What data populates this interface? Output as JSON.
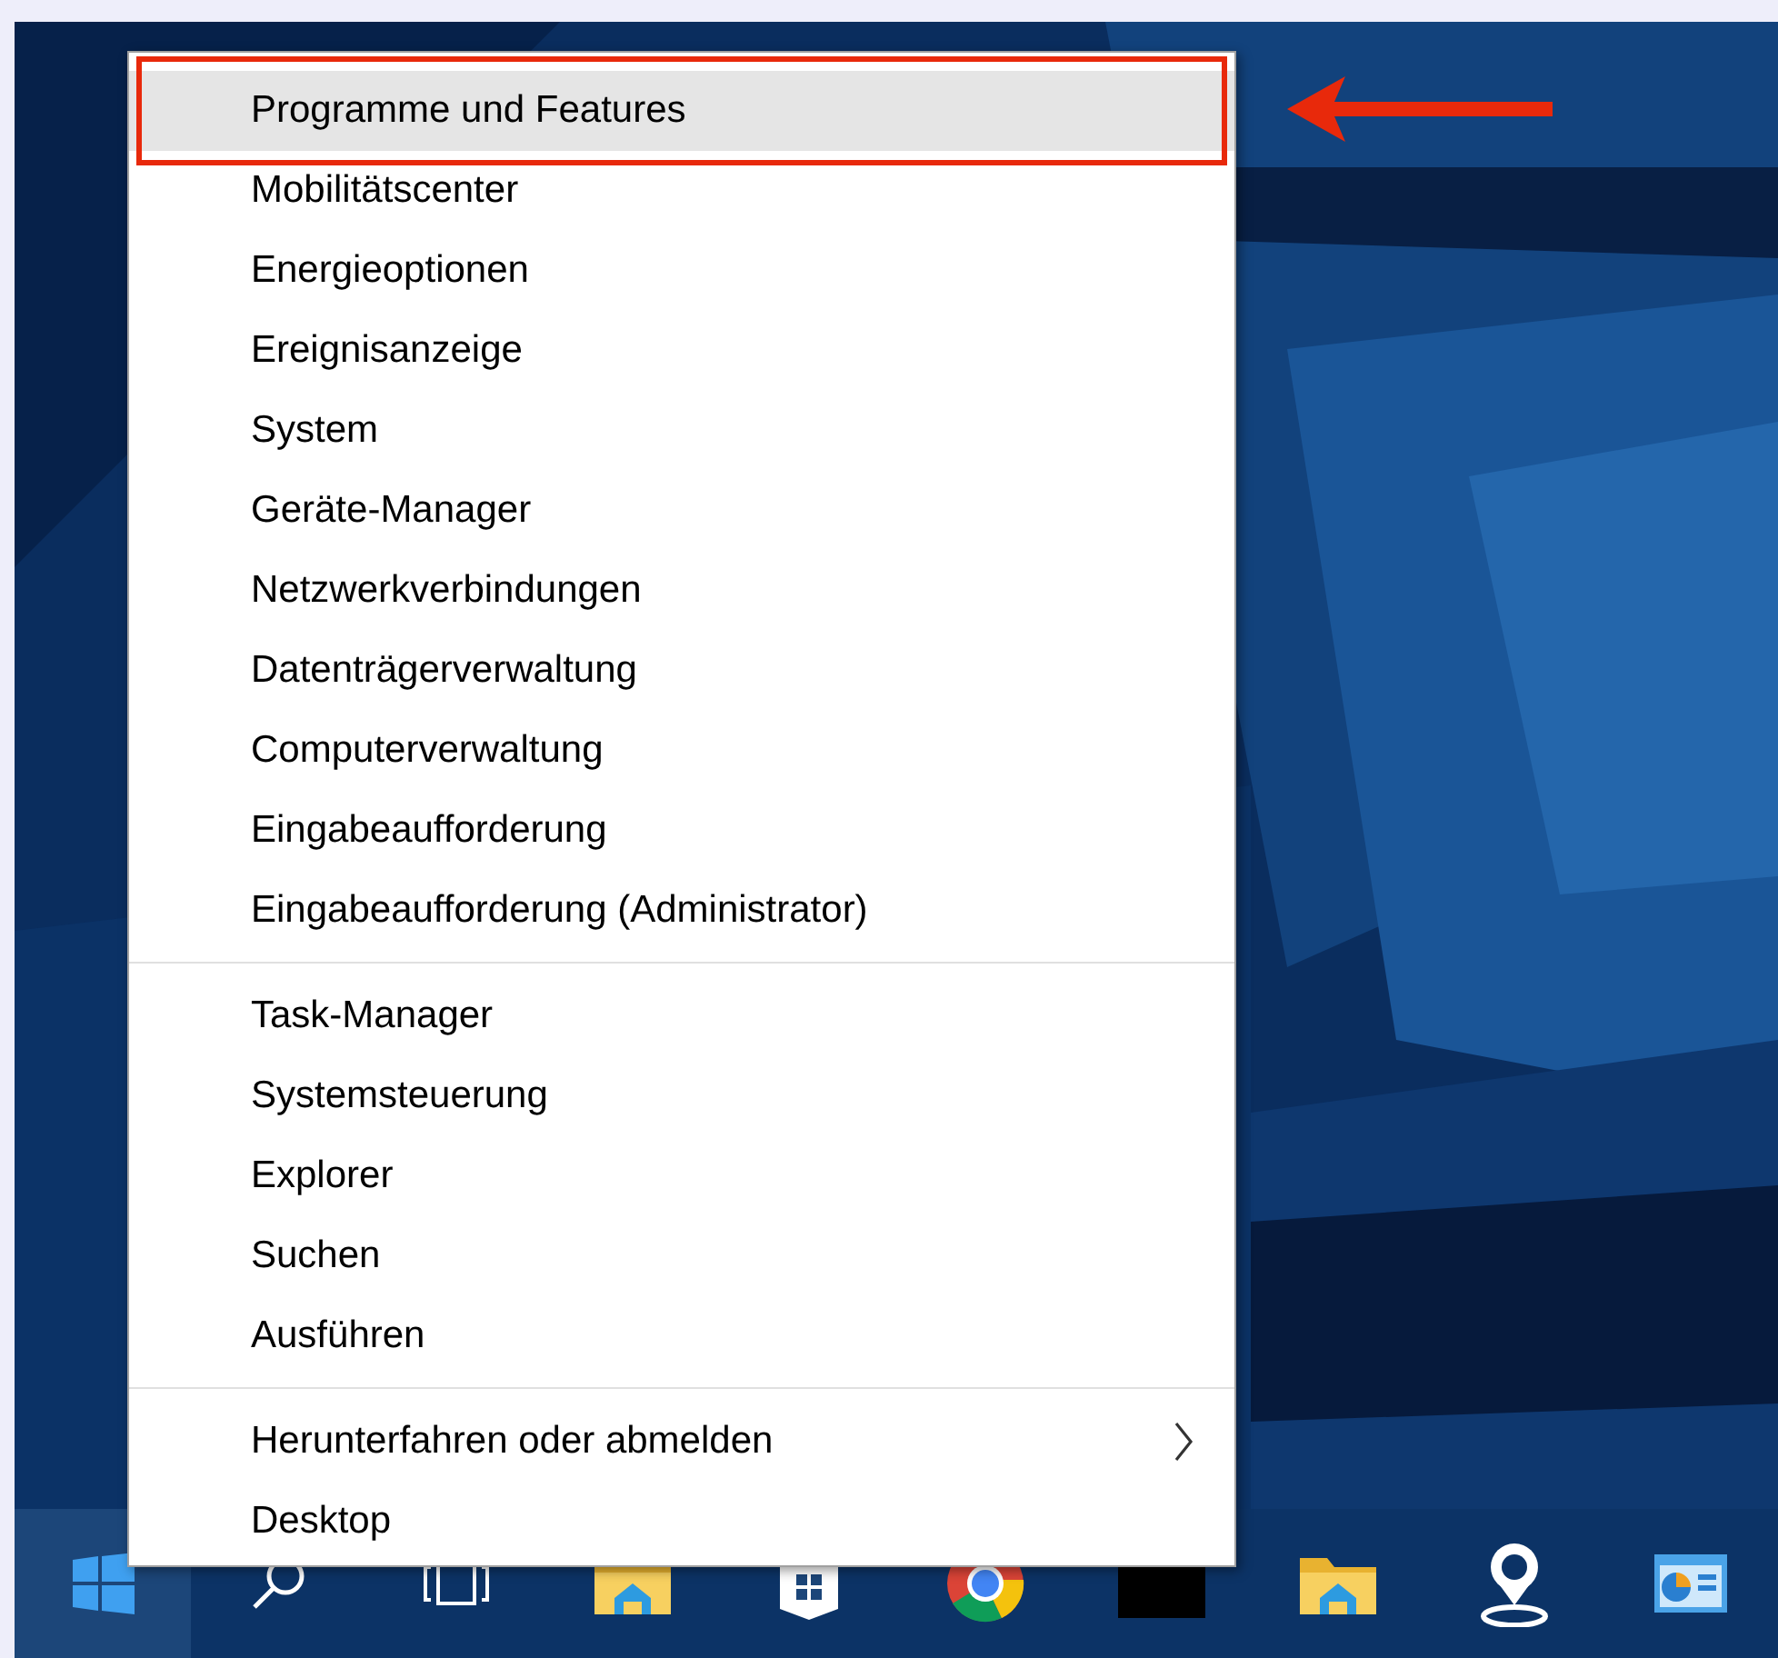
{
  "menu": {
    "groups": [
      {
        "items": [
          {
            "label": "Programme und Features",
            "selected": true,
            "annotated": true,
            "submenu": false
          },
          {
            "label": "Mobilitätscenter",
            "selected": false,
            "annotated": false,
            "submenu": false
          },
          {
            "label": "Energieoptionen",
            "selected": false,
            "annotated": false,
            "submenu": false
          },
          {
            "label": "Ereignisanzeige",
            "selected": false,
            "annotated": false,
            "submenu": false
          },
          {
            "label": "System",
            "selected": false,
            "annotated": false,
            "submenu": false
          },
          {
            "label": "Geräte-Manager",
            "selected": false,
            "annotated": false,
            "submenu": false
          },
          {
            "label": "Netzwerkverbindungen",
            "selected": false,
            "annotated": false,
            "submenu": false
          },
          {
            "label": "Datenträgerverwaltung",
            "selected": false,
            "annotated": false,
            "submenu": false
          },
          {
            "label": "Computerverwaltung",
            "selected": false,
            "annotated": false,
            "submenu": false
          },
          {
            "label": "Eingabeaufforderung",
            "selected": false,
            "annotated": false,
            "submenu": false
          },
          {
            "label": "Eingabeaufforderung (Administrator)",
            "selected": false,
            "annotated": false,
            "submenu": false
          }
        ]
      },
      {
        "items": [
          {
            "label": "Task-Manager",
            "selected": false,
            "annotated": false,
            "submenu": false
          },
          {
            "label": "Systemsteuerung",
            "selected": false,
            "annotated": false,
            "submenu": false
          },
          {
            "label": "Explorer",
            "selected": false,
            "annotated": false,
            "submenu": false
          },
          {
            "label": "Suchen",
            "selected": false,
            "annotated": false,
            "submenu": false
          },
          {
            "label": "Ausführen",
            "selected": false,
            "annotated": false,
            "submenu": false
          }
        ]
      },
      {
        "items": [
          {
            "label": "Herunterfahren oder abmelden",
            "selected": false,
            "annotated": false,
            "submenu": true
          },
          {
            "label": "Desktop",
            "selected": false,
            "annotated": false,
            "submenu": false
          }
        ]
      }
    ]
  },
  "taskbar": {
    "buttons": [
      {
        "kind": "start",
        "selected": true
      },
      {
        "kind": "search",
        "selected": false
      },
      {
        "kind": "taskview",
        "selected": false
      },
      {
        "kind": "folder",
        "selected": false
      },
      {
        "kind": "store",
        "selected": false
      },
      {
        "kind": "ball",
        "selected": false
      },
      {
        "kind": "blackwindow",
        "selected": false
      },
      {
        "kind": "folder",
        "selected": false
      },
      {
        "kind": "pin",
        "selected": false
      },
      {
        "kind": "chartwindow",
        "selected": false
      }
    ]
  }
}
